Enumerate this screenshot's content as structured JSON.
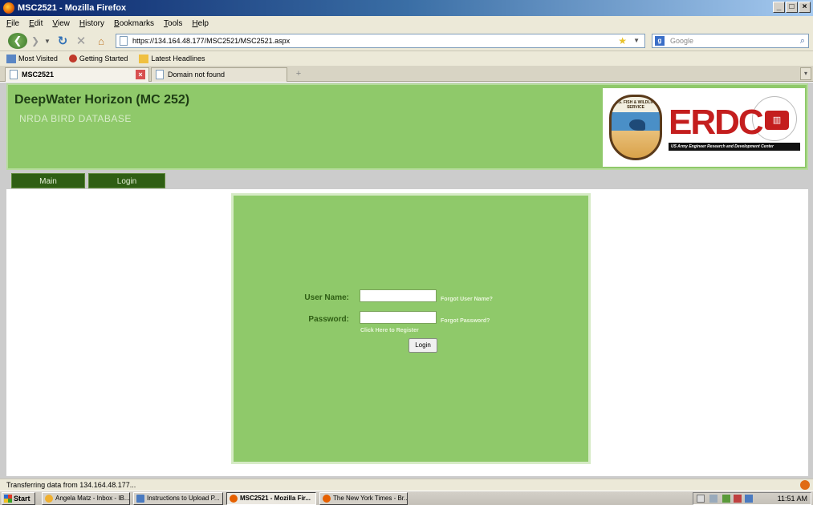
{
  "window": {
    "title": "MSC2521 - Mozilla Firefox",
    "controls": {
      "minimize": "_",
      "maximize": "□",
      "close": "×"
    }
  },
  "menu": {
    "items": [
      "File",
      "Edit",
      "View",
      "History",
      "Bookmarks",
      "Tools",
      "Help"
    ]
  },
  "toolbar": {
    "url": "https://134.164.48.177/MSC2521/MSC2521.aspx",
    "search_placeholder": "Google"
  },
  "bookmarks": {
    "items": [
      "Most Visited",
      "Getting Started",
      "Latest Headlines"
    ]
  },
  "tabs": {
    "active": "MSC2521",
    "inactive": "Domain not found"
  },
  "header": {
    "title": "DeepWater Horizon (MC 252)",
    "subtitle": "NRDA BIRD DATABASE",
    "fws_text": "U.S. FISH & WILDLIFE SERVICE",
    "erdc_text": "ERDC",
    "erdc_tagline": "US Army Engineer Research and Development Center"
  },
  "nav": {
    "main": "Main",
    "login": "Login"
  },
  "login": {
    "user_label": "User Name:",
    "password_label": "Password:",
    "forgot_user": "Forgot User Name?",
    "forgot_password": "Forgot Password?",
    "register": "Click Here to Register",
    "button": "Login"
  },
  "status": {
    "text": "Transferring data from 134.164.48.177..."
  },
  "taskbar": {
    "start": "Start",
    "tasks": [
      "Angela Matz - Inbox - IB...",
      "Instructions to Upload P...",
      "MSC2521 - Mozilla Fir...",
      "The New York Times - Br..."
    ],
    "clock": "11:51 AM"
  }
}
